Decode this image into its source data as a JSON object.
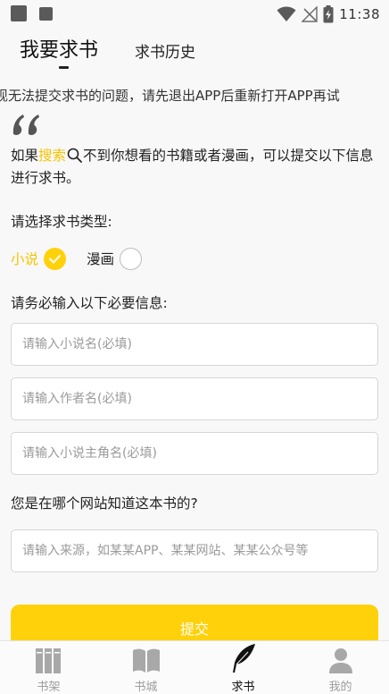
{
  "status_bar": {
    "time": "11:38",
    "icons": [
      "notification-square-icon",
      "notification-square-icon",
      "wifi-icon",
      "no-signal-icon",
      "battery-charging-icon"
    ]
  },
  "tabs": [
    {
      "label": "我要求书",
      "active": true
    },
    {
      "label": "求书历史",
      "active": false
    }
  ],
  "notice": "现无法提交求书的问题，请先退出APP后重新打开APP再试",
  "intro": {
    "before": "如果",
    "highlight": "搜索",
    "after": "不到你想看的书籍或者漫画，可以提交以下信息进行求书。"
  },
  "type_section": {
    "label": "请选择求书类型:",
    "options": [
      {
        "label": "小说",
        "selected": true
      },
      {
        "label": "漫画",
        "selected": false
      }
    ]
  },
  "required_section": {
    "label": "请务必输入以下必要信息:",
    "fields": [
      {
        "placeholder": "请输入小说名(必填)",
        "value": ""
      },
      {
        "placeholder": "请输入作者名(必填)",
        "value": ""
      },
      {
        "placeholder": "请输入小说主角名(必填)",
        "value": ""
      }
    ]
  },
  "source_section": {
    "label": "您是在哪个网站知道这本书的?",
    "placeholder": "请输入来源，如某某APP、某某网站、某某公众号等",
    "value": ""
  },
  "submit_label": "提交",
  "bottom_nav": [
    {
      "label": "书架",
      "icon": "bookshelf-icon",
      "active": false
    },
    {
      "label": "书城",
      "icon": "open-book-icon",
      "active": false
    },
    {
      "label": "求书",
      "icon": "feather-quill-icon",
      "active": true
    },
    {
      "label": "我的",
      "icon": "person-icon",
      "active": false
    }
  ],
  "colors": {
    "accent": "#ffd10a",
    "accent_text": "#f5c400",
    "inactive_nav": "#9e9e9e",
    "active_nav": "#111111"
  }
}
